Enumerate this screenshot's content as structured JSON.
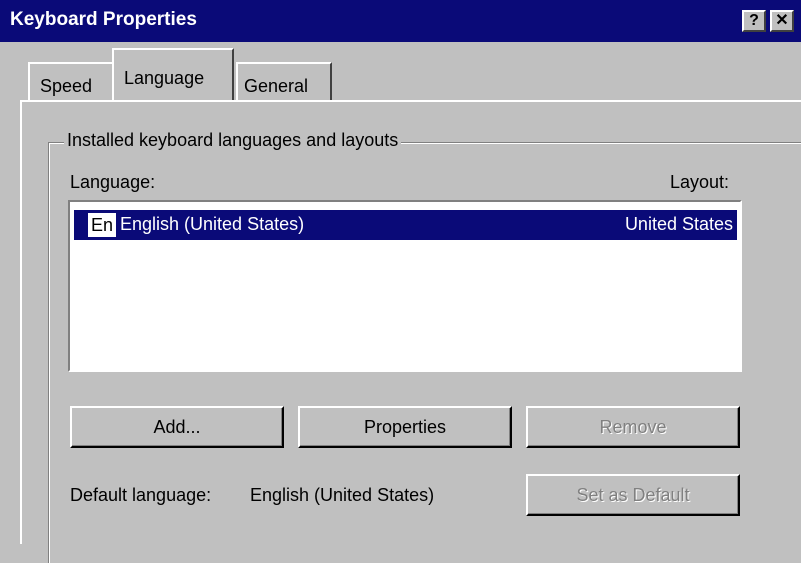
{
  "window": {
    "title": "Keyboard Properties",
    "help_button": "?",
    "close_button": "✕"
  },
  "tabs": [
    {
      "label": "Speed",
      "selected": false
    },
    {
      "label": "Language",
      "selected": true
    },
    {
      "label": "General",
      "selected": false
    }
  ],
  "group": {
    "title": "Installed keyboard languages and layouts",
    "header_language": "Language:",
    "header_layout": "Layout:",
    "rows": [
      {
        "badge": "En",
        "language": "English (United States)",
        "layout": "United States",
        "selected": true
      }
    ]
  },
  "buttons": {
    "add": "Add...",
    "properties": "Properties",
    "remove": "Remove",
    "set_default": "Set as Default"
  },
  "default_language": {
    "label": "Default language:",
    "value": "English (United States)"
  },
  "colors": {
    "titlebar": "#0a0a78",
    "face": "#c0c0c0",
    "selection": "#0a0a78"
  }
}
